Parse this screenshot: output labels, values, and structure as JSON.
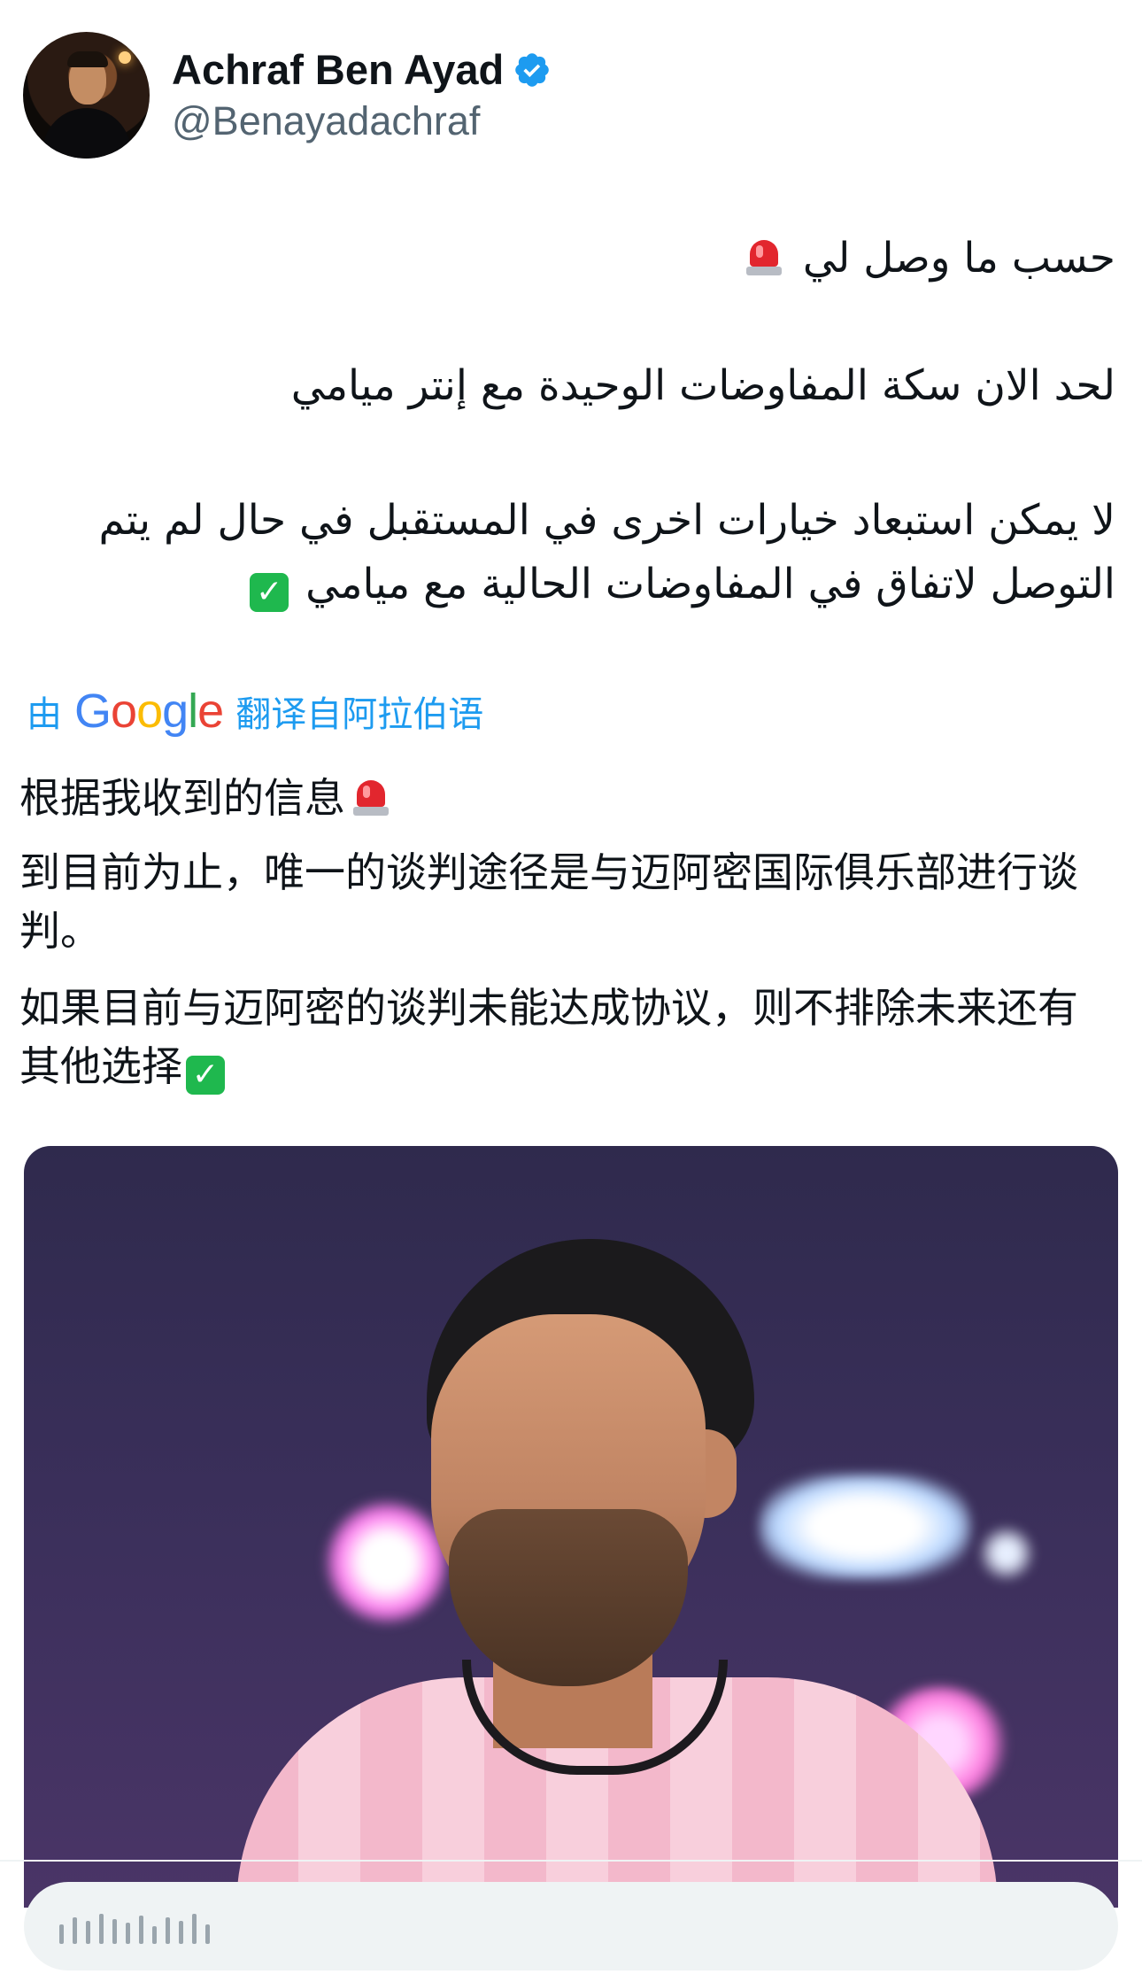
{
  "author": {
    "display_name": "Achraf Ben Ayad",
    "handle": "@Benayadachraf",
    "verified": true,
    "verified_color": "#1d9bf0"
  },
  "tweet": {
    "arabic": {
      "line1": "حسب ما وصل لي",
      "line2": "لحد الان سكة المفاوضات الوحيدة مع إنتر ميامي",
      "line3": "لا يمكن استبعاد خيارات اخرى في المستقبل في حال لم يتم التوصل لاتفاق في المفاوضات الحالية مع ميامي"
    },
    "translation": {
      "prefix": "由",
      "provider": "Google",
      "suffix": "翻译自阿拉伯语",
      "link_color": "#1d9bf0",
      "para1": "根据我收到的信息",
      "para2": "到目前为止，唯一的谈判途径是与迈阿密国际俱乐部进行谈判。",
      "para3": "如果目前与迈阿密的谈判未能达成协议，则不排除未来还有其他选择"
    },
    "emojis": {
      "siren": "police-siren-icon",
      "check": "check-mark-button-icon"
    }
  },
  "reply_bar": {
    "placeholder_icon": "reply-placeholder-icon"
  }
}
